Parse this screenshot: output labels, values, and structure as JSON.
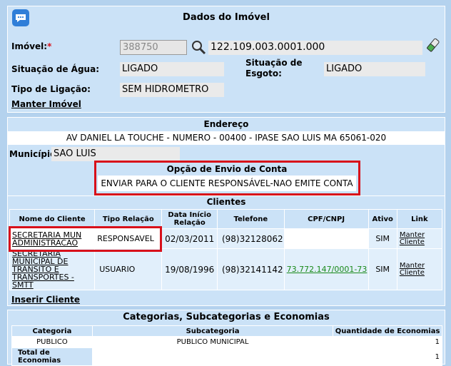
{
  "header": {
    "title": "Dados do Imóvel"
  },
  "imovel": {
    "label": "Imóvel:",
    "required_mark": "*",
    "code": "388750",
    "inscricao": "122.109.003.0001.000",
    "agua_label": "Situação de Água:",
    "agua_value": "LIGADO",
    "esgoto_label": "Situação de Esgoto:",
    "esgoto_value": "LIGADO",
    "ligacao_label": "Tipo de Ligação:",
    "ligacao_value": "SEM HIDROMETRO",
    "manter_link": "Manter Imóvel"
  },
  "endereco": {
    "title": "Endereço",
    "value": "AV DANIEL LA TOUCHE - NUMERO - 00400 - IPASE SAO LUIS MA 65061-020",
    "municipio_label": "Município:",
    "municipio_value": "SAO LUIS"
  },
  "envio": {
    "title": "Opção de Envio de Conta",
    "value": "ENVIAR PARA O CLIENTE RESPONSÁVEL-NAO EMITE CONTA"
  },
  "clientes": {
    "title": "Clientes",
    "columns": [
      "Nome do Cliente",
      "Tipo Relação",
      "Data Início Relação",
      "Telefone",
      "CPF/CNPJ",
      "Ativo",
      "Link"
    ],
    "rows": [
      {
        "nome": "SECRETARIA MUN ADMINISTRACAO",
        "tipo": "RESPONSAVEL",
        "data": "02/03/2011",
        "telefone": "(98)32128062",
        "cpf": "",
        "ativo": "SIM",
        "link": "Manter Cliente"
      },
      {
        "nome": "SECRETARIA MUNICIPAL DE TRANSITO E TRANSPORTES - SMTT",
        "tipo": "USUARIO",
        "data": "19/08/1996",
        "telefone": "(98)32141142",
        "cpf": "73.772.147/0001-73",
        "ativo": "SIM",
        "link": "Manter Cliente"
      }
    ],
    "inserir_link": "Inserir Cliente"
  },
  "categorias": {
    "title": "Categorias, Subcategorias e Economias",
    "col_categoria": "Categoria",
    "col_subcategoria": "Subcategoria",
    "col_quantidade": "Quantidade de Economias",
    "row": {
      "categoria": "PUBLICO",
      "subcategoria": "PUBLICO MUNICIPAL",
      "quantidade": "1"
    },
    "total_label": "Total de Economias",
    "total_value": "1"
  }
}
